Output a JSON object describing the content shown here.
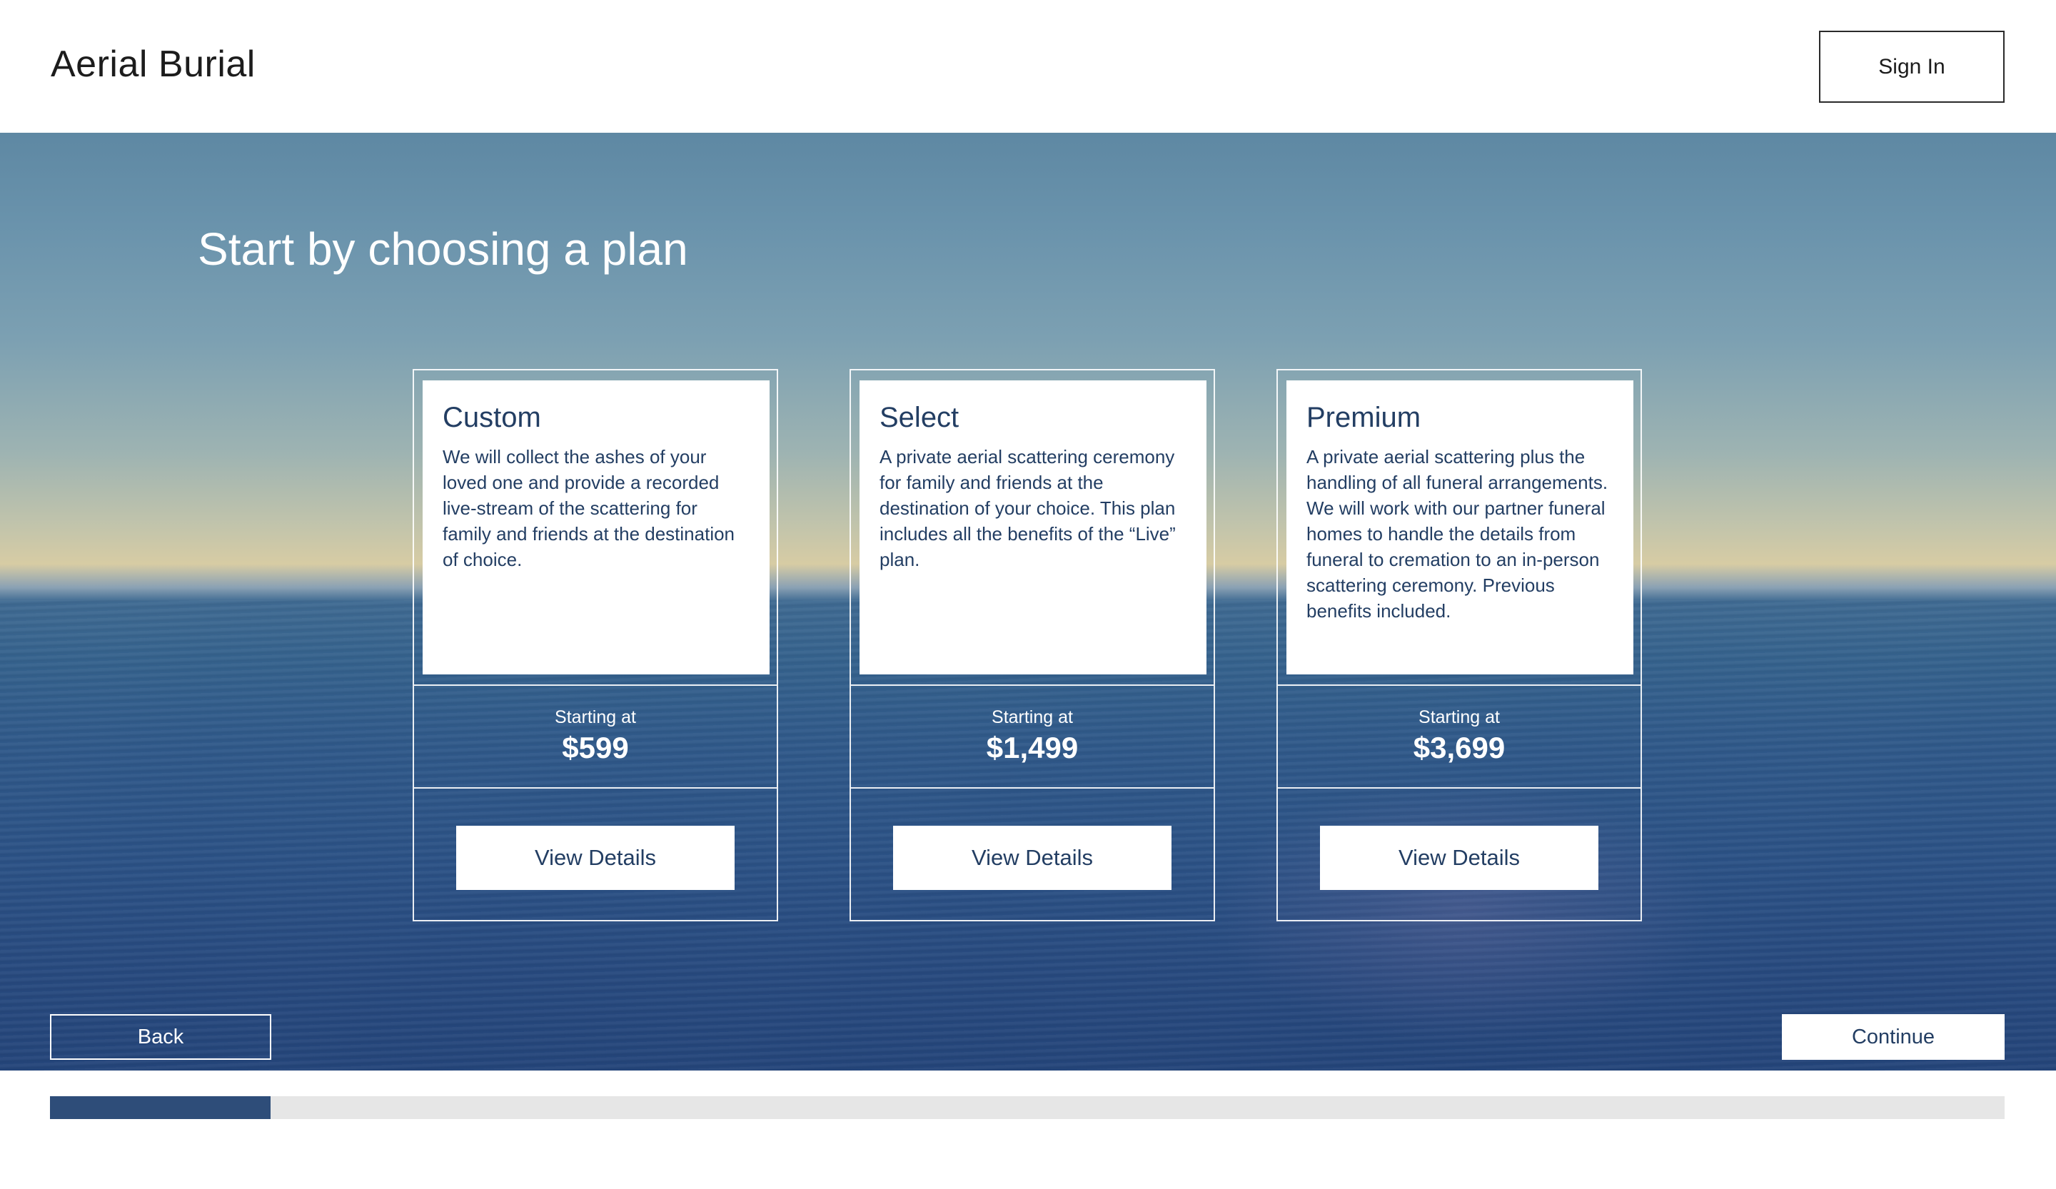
{
  "header": {
    "brand": "Aerial Burial",
    "sign_in_label": "Sign In"
  },
  "main": {
    "title": "Start by choosing a plan",
    "plans": [
      {
        "name": "Custom",
        "description": "We will collect the ashes of your loved one and provide a recorded live-stream of the scattering for family and friends at the destination of  choice.",
        "starting_label": "Starting at",
        "price": "$599",
        "button_label": "View Details"
      },
      {
        "name": "Select",
        "description": "A private aerial scattering ceremony for family and friends at the destination of your choice. This plan includes all the benefits of the “Live” plan.",
        "starting_label": "Starting at",
        "price": "$1,499",
        "button_label": "View Details"
      },
      {
        "name": "Premium",
        "description": "A private aerial scattering plus the handling of all funeral arrangements. We will work with our partner funeral homes to handle the details from funeral to cremation to an in-person scattering ceremony. Previous benefits included.",
        "starting_label": "Starting at",
        "price": "$3,699",
        "button_label": "View Details"
      }
    ]
  },
  "footer_nav": {
    "back_label": "Back",
    "continue_label": "Continue"
  },
  "progress": {
    "fraction": 0.113
  },
  "colors": {
    "accent": "#233e63",
    "progress_fill": "#2e4d79",
    "progress_track": "#e6e6e6"
  }
}
